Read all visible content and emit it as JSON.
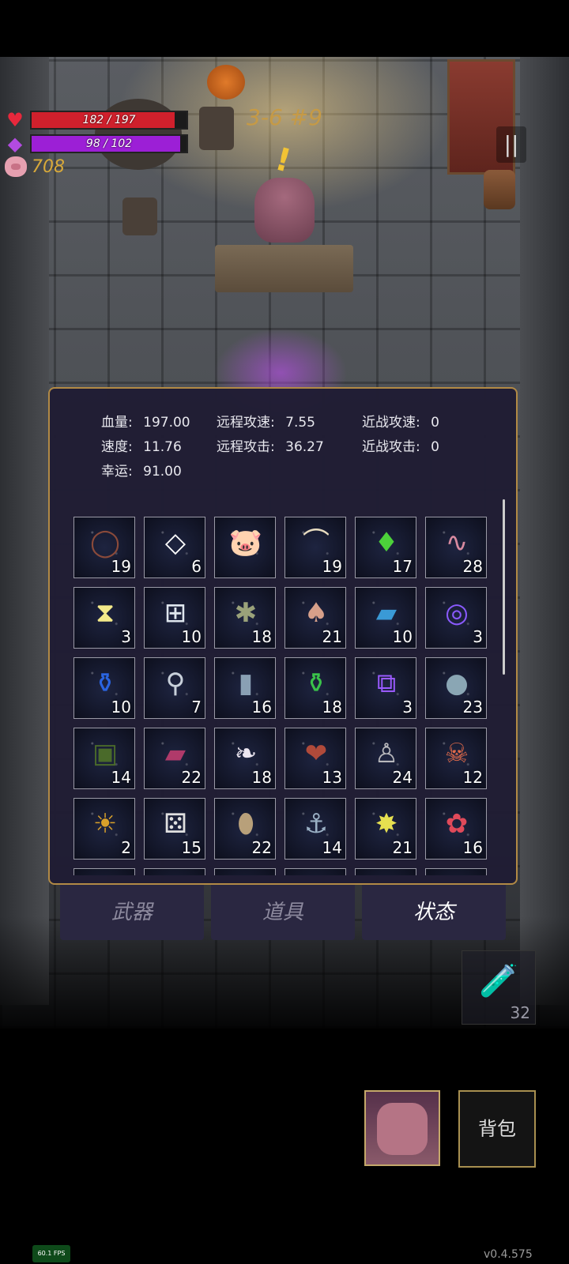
{
  "hud": {
    "hp_text": "182 / 197",
    "hp_fraction": 0.924,
    "mp_text": "98 / 102",
    "mp_fraction": 0.961,
    "coins": "708",
    "level": "3-6 #9",
    "hp_color": "#d0202c",
    "mp_color": "#9c1fd6"
  },
  "stats": {
    "hp_label": "血量:",
    "hp_value": "197.00",
    "speed_label": "速度:",
    "speed_value": "11.76",
    "luck_label": "幸运:",
    "luck_value": "91.00",
    "ranged_speed_label": "远程攻速:",
    "ranged_speed_value": "7.55",
    "ranged_atk_label": "远程攻击:",
    "ranged_atk_value": "36.27",
    "melee_speed_label": "近战攻速:",
    "melee_speed_value": "0",
    "melee_atk_label": "近战攻击:",
    "melee_atk_value": "0"
  },
  "items": [
    {
      "icon": "thorn-crown-icon",
      "count": "19"
    },
    {
      "icon": "diamond-badge-icon",
      "count": "6"
    },
    {
      "icon": "piggy-bank-icon",
      "count": ""
    },
    {
      "icon": "horn-icon",
      "count": "19"
    },
    {
      "icon": "green-crystal-icon",
      "count": "17"
    },
    {
      "icon": "worm-icon",
      "count": "28"
    },
    {
      "icon": "hourglass-card-icon",
      "count": "3"
    },
    {
      "icon": "medkit-icon",
      "count": "10"
    },
    {
      "icon": "frog-icon",
      "count": "18"
    },
    {
      "icon": "mushroom-icon",
      "count": "21"
    },
    {
      "icon": "blue-book-icon",
      "count": "10"
    },
    {
      "icon": "swirl-rune-icon",
      "count": "3"
    },
    {
      "icon": "blue-potion-icon",
      "count": "10"
    },
    {
      "icon": "magnifier-icon",
      "count": "7"
    },
    {
      "icon": "vial-icon",
      "count": "16"
    },
    {
      "icon": "green-potion-icon",
      "count": "18"
    },
    {
      "icon": "purple-rune-icon",
      "count": "3"
    },
    {
      "icon": "stone-icon",
      "count": "23"
    },
    {
      "icon": "skull-book-icon",
      "count": "14"
    },
    {
      "icon": "red-book-icon",
      "count": "22"
    },
    {
      "icon": "feather-icon",
      "count": "18"
    },
    {
      "icon": "heart-organ-icon",
      "count": "13"
    },
    {
      "icon": "ghost-statue-icon",
      "count": "24"
    },
    {
      "icon": "feather-skull-icon",
      "count": "12"
    },
    {
      "icon": "sun-book-icon",
      "count": "2"
    },
    {
      "icon": "dice-icon",
      "count": "15"
    },
    {
      "icon": "egg-icon",
      "count": "22"
    },
    {
      "icon": "hook-icon",
      "count": "14"
    },
    {
      "icon": "star-icon",
      "count": "21"
    },
    {
      "icon": "flower-icon",
      "count": "16"
    }
  ],
  "tabs": {
    "weapons": "武器",
    "items": "道具",
    "status": "状态"
  },
  "quick_potion_count": "32",
  "bag_label": "背包",
  "fps": "60.1 FPS",
  "version": "v0.4.575"
}
